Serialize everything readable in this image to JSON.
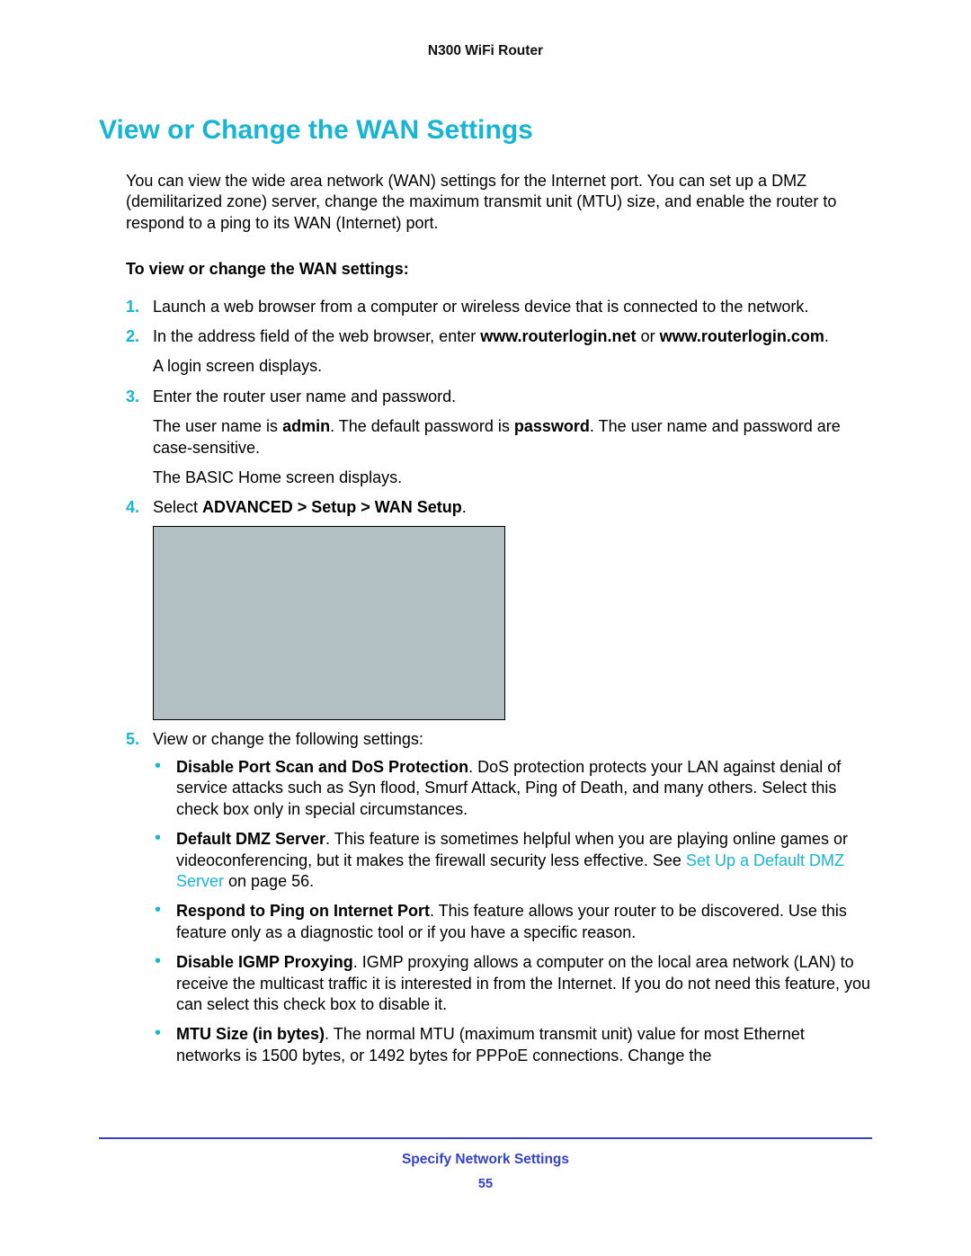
{
  "header": {
    "product": "N300 WiFi Router"
  },
  "section": {
    "title": "View or Change the WAN Settings"
  },
  "intro": "You can view the wide area network (WAN) settings for the Internet port. You can set up a DMZ (demilitarized zone) server, change the maximum transmit unit (MTU) size, and enable the router to respond to a ping to its WAN (Internet) port.",
  "subhead": "To view or change the WAN settings:",
  "steps": {
    "s1": {
      "num": "1.",
      "text": "Launch a web browser from a computer or wireless device that is connected to the network."
    },
    "s2": {
      "num": "2.",
      "lead": "In the address field of the web browser, enter ",
      "url1": "www.routerlogin.net",
      "mid": " or ",
      "url2": "www.routerlogin.com",
      "tail": ".",
      "after": "A login screen displays."
    },
    "s3": {
      "num": "3.",
      "text": "Enter the router user name and password.",
      "after1_a": "The user name is ",
      "after1_b": "admin",
      "after1_c": ". The default password is ",
      "after1_d": "password",
      "after1_e": ". The user name and password are case-sensitive.",
      "after2": "The BASIC Home screen displays."
    },
    "s4": {
      "num": "4.",
      "lead": "Select ",
      "path": "ADVANCED > Setup > WAN Setup",
      "tail": "."
    },
    "s5": {
      "num": "5.",
      "text": "View or change the following settings:",
      "bullets": {
        "b1": {
          "title": "Disable Port Scan and DoS Protection",
          "body": ". DoS protection protects your LAN against denial of service attacks such as Syn flood, Smurf Attack, Ping of Death, and many others. Select this check box only in special circumstances."
        },
        "b2": {
          "title": "Default DMZ Server",
          "body_a": ". This feature is sometimes helpful when you are playing online games or videoconferencing, but it makes the firewall security less effective. See ",
          "link": "Set Up a Default DMZ Server",
          "body_b": " on page 56."
        },
        "b3": {
          "title": "Respond to Ping on Internet Port",
          "body": ". This feature allows your router to be discovered. Use this feature only as a diagnostic tool or if you have a specific reason."
        },
        "b4": {
          "title": "Disable IGMP Proxying",
          "body": ". IGMP proxying allows a computer on the local area network (LAN) to receive the multicast traffic it is interested in from the Internet. If you do not need this feature, you can select this check box to disable it."
        },
        "b5": {
          "title": "MTU Size (in bytes)",
          "body": ". The normal MTU (maximum transmit unit) value for most Ethernet networks is 1500 bytes, or 1492 bytes for PPPoE connections. Change the"
        }
      }
    }
  },
  "footer": {
    "chapter": "Specify Network Settings",
    "page": "55"
  }
}
